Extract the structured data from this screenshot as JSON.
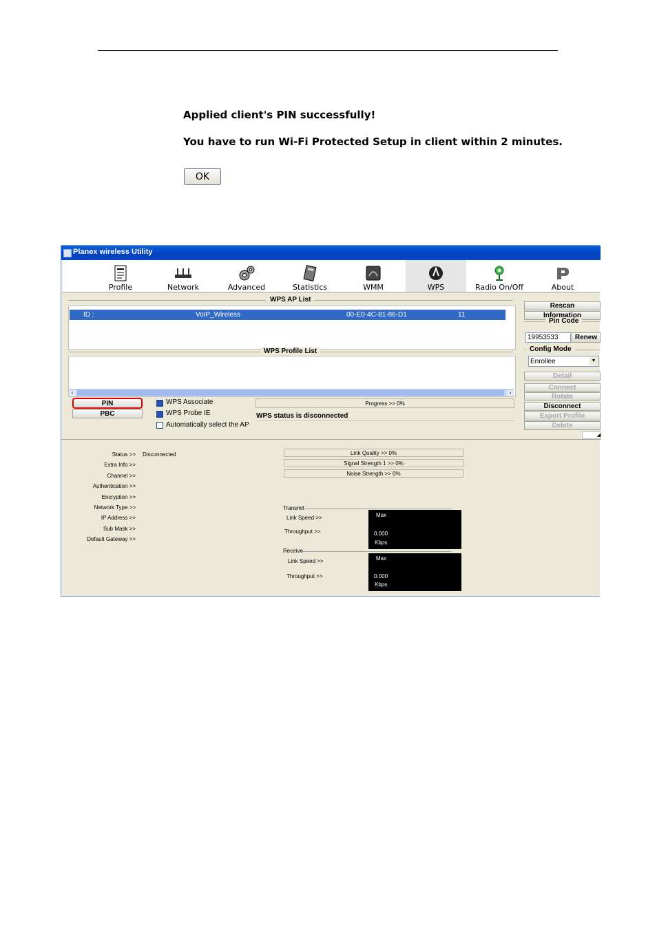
{
  "dialog": {
    "line1": "Applied client's PIN successfully!",
    "line2": "You have to run Wi-Fi Protected Setup in client within 2 minutes.",
    "ok_label": "OK"
  },
  "window": {
    "title": "Planex wireless Utility",
    "toolbar": [
      {
        "label": "Profile",
        "icon": "profile-icon"
      },
      {
        "label": "Network",
        "icon": "network-icon"
      },
      {
        "label": "Advanced",
        "icon": "advanced-icon"
      },
      {
        "label": "Statistics",
        "icon": "statistics-icon"
      },
      {
        "label": "WMM",
        "icon": "wmm-icon"
      },
      {
        "label": "WPS",
        "icon": "wps-icon"
      },
      {
        "label": "Radio On/Off",
        "icon": "radio-icon"
      },
      {
        "label": "About",
        "icon": "about-icon"
      }
    ],
    "ap_list": {
      "title": "WPS AP List",
      "row": {
        "id": "ID :",
        "ssid": "VoIP_Wireless",
        "mac": "00-E0-4C-81-86-D1",
        "channel": "11"
      }
    },
    "profile_list": {
      "title": "WPS Profile List"
    },
    "pin_label": "PIN",
    "pbc_label": "PBC",
    "wps_associate": "WPS Associate",
    "wps_probe": "WPS Probe IE",
    "auto_select": "Automatically select the AP",
    "progress_text": "Progress >> 0%",
    "wps_status": "WPS status is disconnected",
    "side": {
      "rescan": "Rescan",
      "information": "Information",
      "pin_code_label": "Pin Code",
      "pin_code_value": "19953533",
      "renew": "Renew",
      "config_mode_label": "Config Mode",
      "config_mode_value": "Enrollee",
      "detail": "Detail",
      "connect": "Connect",
      "rotate": "Rotate",
      "disconnect": "Disconnect",
      "export_profile": "Export Profile",
      "delete": "Delete"
    },
    "status": {
      "labels": [
        "Status >>",
        "Extra Info >>",
        "Channel >>",
        "Authentication >>",
        "Encryption >>",
        "Network Type >>",
        "IP Address >>",
        "Sub Mask >>",
        "Default Gateway >>"
      ],
      "status_value": "Disconnected",
      "link_quality": "Link Quality >> 0%",
      "signal_strength": "Signal Strength 1 >> 0%",
      "noise_strength": "Noise Strength >> 0%",
      "transmit": {
        "title": "Transmit",
        "link_speed": "Link Speed >>",
        "throughput": "Throughput >>",
        "max": "Max",
        "value": "0.000",
        "unit": "Kbps"
      },
      "receive": {
        "title": "Receive",
        "link_speed": "Link Speed >>",
        "throughput": "Throughput >>",
        "max": "Max",
        "value": "0.000",
        "unit": "Kbps"
      }
    }
  }
}
